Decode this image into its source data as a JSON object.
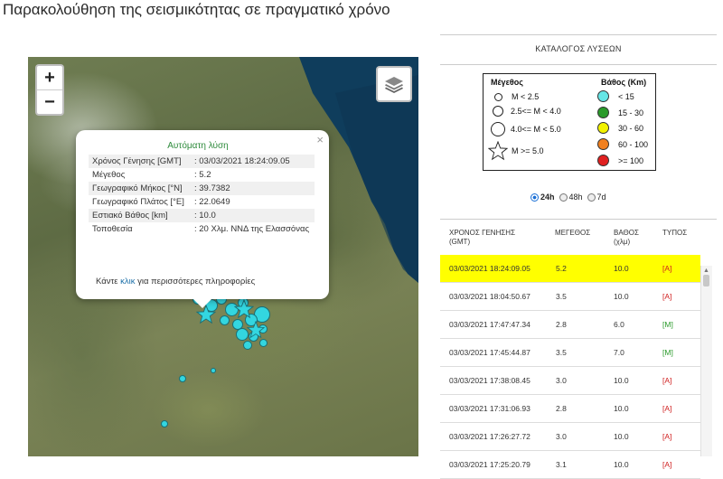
{
  "page": {
    "title": "Παρακολούθηση της σεισμικότητας σε πραγματικό χρόνο"
  },
  "map": {
    "zoom_in": "+",
    "zoom_out": "−",
    "layers_icon": "layers-icon",
    "quake_color": "#33d6e0"
  },
  "popup": {
    "title": "Αυτόματη λύση",
    "close": "×",
    "fields": [
      {
        "label": "Χρόνος Γένησης [GMT]",
        "value": ": 03/03/2021 18:24:09.05"
      },
      {
        "label": "Μέγεθος",
        "value": ": 5.2"
      },
      {
        "label": "Γεωγραφικό Μήκος [°N]",
        "value": ": 39.7382"
      },
      {
        "label": "Γεωγραφικό Πλάτος [°E]",
        "value": ": 22.0649"
      },
      {
        "label": "Εστιακό Βάθος [km]",
        "value": ": 10.0"
      },
      {
        "label": "Τοποθεσία",
        "value": ": 20 Χλμ. ΝΝΔ της Ελασσόνας"
      }
    ],
    "more_prefix": "Κάντε ",
    "more_link": "κλικ",
    "more_suffix": " για περισσότερες πληροφορίες"
  },
  "catalog": {
    "title": "ΚΑΤΑΛΟΓΟΣ ΛΥΣΕΩΝ"
  },
  "legend": {
    "magnitude_header": "Μέγεθος",
    "depth_header": "Βάθος (Km)",
    "magnitudes": [
      "M < 2.5",
      "2.5<= M < 4.0",
      "4.0<= M < 5.0",
      "M >= 5.0"
    ],
    "depths": [
      {
        "label": "< 15",
        "color": "#66e6e6"
      },
      {
        "label": "15 - 30",
        "color": "#2a9a2a"
      },
      {
        "label": "30 - 60",
        "color": "#f2f200"
      },
      {
        "label": "60 - 100",
        "color": "#f08020"
      },
      {
        "label": ">= 100",
        "color": "#e02020"
      }
    ]
  },
  "period": {
    "options": [
      "24h",
      "48h",
      "7d"
    ],
    "selected": "24h"
  },
  "table": {
    "headers": {
      "time": "ΧΡΟΝΟΣ ΓΕΝΗΣΗΣ (GMT)",
      "magnitude": "ΜΕΓΕΘΟΣ",
      "depth": "ΒΑΘΟΣ (χλμ)",
      "type": "ΤΥΠΟΣ"
    },
    "rows": [
      {
        "time": "03/03/2021 18:24:09.05",
        "mag": "5.2",
        "depth": "10.0",
        "type": "[A]"
      },
      {
        "time": "03/03/2021 18:04:50.67",
        "mag": "3.5",
        "depth": "10.0",
        "type": "[A]"
      },
      {
        "time": "03/03/2021 17:47:47.34",
        "mag": "2.8",
        "depth": "6.0",
        "type": "[M]"
      },
      {
        "time": "03/03/2021 17:45:44.87",
        "mag": "3.5",
        "depth": "7.0",
        "type": "[M]"
      },
      {
        "time": "03/03/2021 17:38:08.45",
        "mag": "3.0",
        "depth": "10.0",
        "type": "[A]"
      },
      {
        "time": "03/03/2021 17:31:06.93",
        "mag": "2.8",
        "depth": "10.0",
        "type": "[A]"
      },
      {
        "time": "03/03/2021 17:26:27.72",
        "mag": "3.0",
        "depth": "10.0",
        "type": "[A]"
      },
      {
        "time": "03/03/2021 17:25:20.79",
        "mag": "3.1",
        "depth": "10.0",
        "type": "[A]"
      }
    ]
  }
}
